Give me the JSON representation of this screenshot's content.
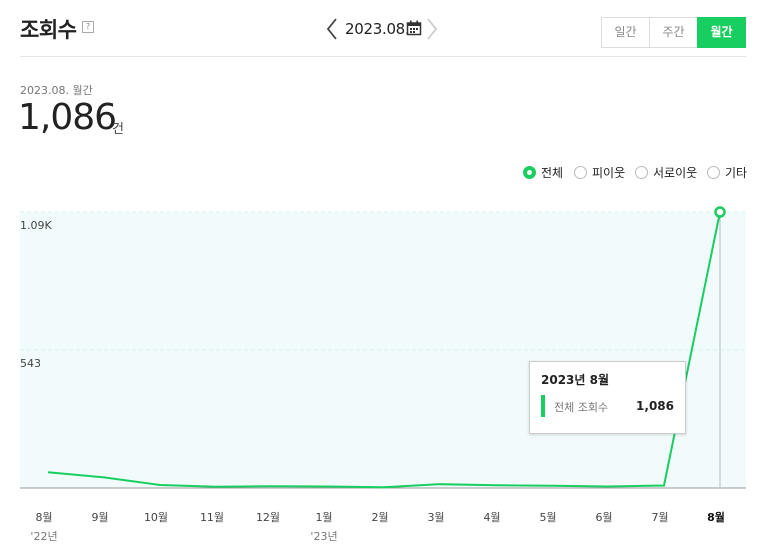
{
  "header": {
    "title": "조회수",
    "help": "?",
    "period": "2023.08.",
    "tabs": [
      "일간",
      "주간",
      "월간"
    ],
    "active_tab": "월간"
  },
  "summary": {
    "period_label": "2023.08. 월간",
    "value": "1,086",
    "unit": "건"
  },
  "legend": {
    "options": [
      "전체",
      "피이웃",
      "서로이웃",
      "기타"
    ],
    "selected": "전체"
  },
  "tooltip": {
    "title": "2023년 8월",
    "label": "전체 조회수",
    "value": "1,086"
  },
  "colors": {
    "accent": "#19ce60",
    "plot_bg": "#f2fbfc",
    "grid": "#d8ecef"
  },
  "chart_data": {
    "type": "line",
    "categories": [
      "8월",
      "9월",
      "10월",
      "11월",
      "12월",
      "1월",
      "2월",
      "3월",
      "4월",
      "5월",
      "6월",
      "7월",
      "8월"
    ],
    "year_labels": [
      {
        "index": 0,
        "text": "'22년"
      },
      {
        "index": 5,
        "text": "'23년"
      }
    ],
    "series": [
      {
        "values": [
          62,
          42,
          12,
          5,
          7,
          6,
          3,
          15,
          11,
          9,
          6,
          10,
          1086
        ]
      }
    ],
    "y_ticks": [
      {
        "value": 1086,
        "label": "1.09K"
      },
      {
        "value": 543,
        "label": "543"
      }
    ],
    "ylim": [
      0,
      1086
    ],
    "highlight_index": 12,
    "grid": true
  }
}
